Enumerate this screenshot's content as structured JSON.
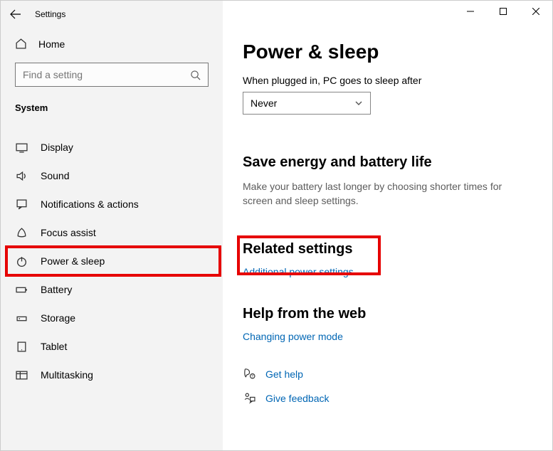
{
  "window": {
    "title": "Settings"
  },
  "sidebar": {
    "home": "Home",
    "search_placeholder": "Find a setting",
    "section": "System",
    "items": [
      {
        "label": "Display"
      },
      {
        "label": "Sound"
      },
      {
        "label": "Notifications & actions"
      },
      {
        "label": "Focus assist"
      },
      {
        "label": "Power & sleep"
      },
      {
        "label": "Battery"
      },
      {
        "label": "Storage"
      },
      {
        "label": "Tablet"
      },
      {
        "label": "Multitasking"
      }
    ]
  },
  "main": {
    "heading": "Power & sleep",
    "sleep_label": "When plugged in, PC goes to sleep after",
    "sleep_value": "Never",
    "energy_heading": "Save energy and battery life",
    "energy_text": "Make your battery last longer by choosing shorter times for screen and sleep settings.",
    "related_heading": "Related settings",
    "related_link": "Additional power settings",
    "help_heading": "Help from the web",
    "help_link": "Changing power mode",
    "gethelp": "Get help",
    "feedback": "Give feedback"
  }
}
